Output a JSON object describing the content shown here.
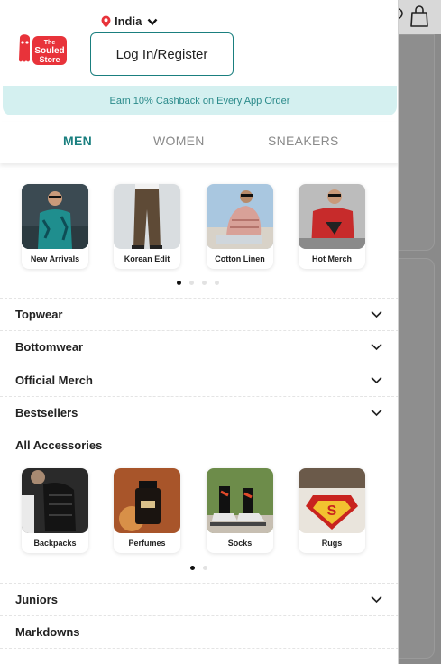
{
  "header": {
    "country": "India",
    "login_label": "Log In/Register",
    "logo_lines": [
      "The",
      "Souled",
      "Store"
    ]
  },
  "cashback_text": "Earn 10% Cashback on Every App Order",
  "tabs": [
    {
      "label": "MEN",
      "active": true
    },
    {
      "label": "WOMEN",
      "active": false
    },
    {
      "label": "SNEAKERS",
      "active": false
    }
  ],
  "featured": [
    {
      "label": "New Arrivals"
    },
    {
      "label": "Korean Edit"
    },
    {
      "label": "Cotton Linen"
    },
    {
      "label": "Hot Merch"
    }
  ],
  "featured_page": {
    "current": 1,
    "total": 4
  },
  "menu_items": [
    {
      "label": "Topwear",
      "expandable": true
    },
    {
      "label": "Bottomwear",
      "expandable": true
    },
    {
      "label": "Official Merch",
      "expandable": true
    },
    {
      "label": "Bestsellers",
      "expandable": true
    },
    {
      "label": "All Accessories",
      "expandable": false
    }
  ],
  "accessories": [
    {
      "label": "Backpacks"
    },
    {
      "label": "Perfumes"
    },
    {
      "label": "Socks"
    },
    {
      "label": "Rugs"
    }
  ],
  "accessories_page": {
    "current": 1,
    "total": 2
  },
  "menu_items_bottom": [
    {
      "label": "Juniors",
      "expandable": true
    },
    {
      "label": "Markdowns",
      "expandable": false
    }
  ],
  "colors": {
    "accent": "#1a7f7f",
    "brand_red": "#e8333a",
    "cashback_bg": "#d4f0f0"
  }
}
